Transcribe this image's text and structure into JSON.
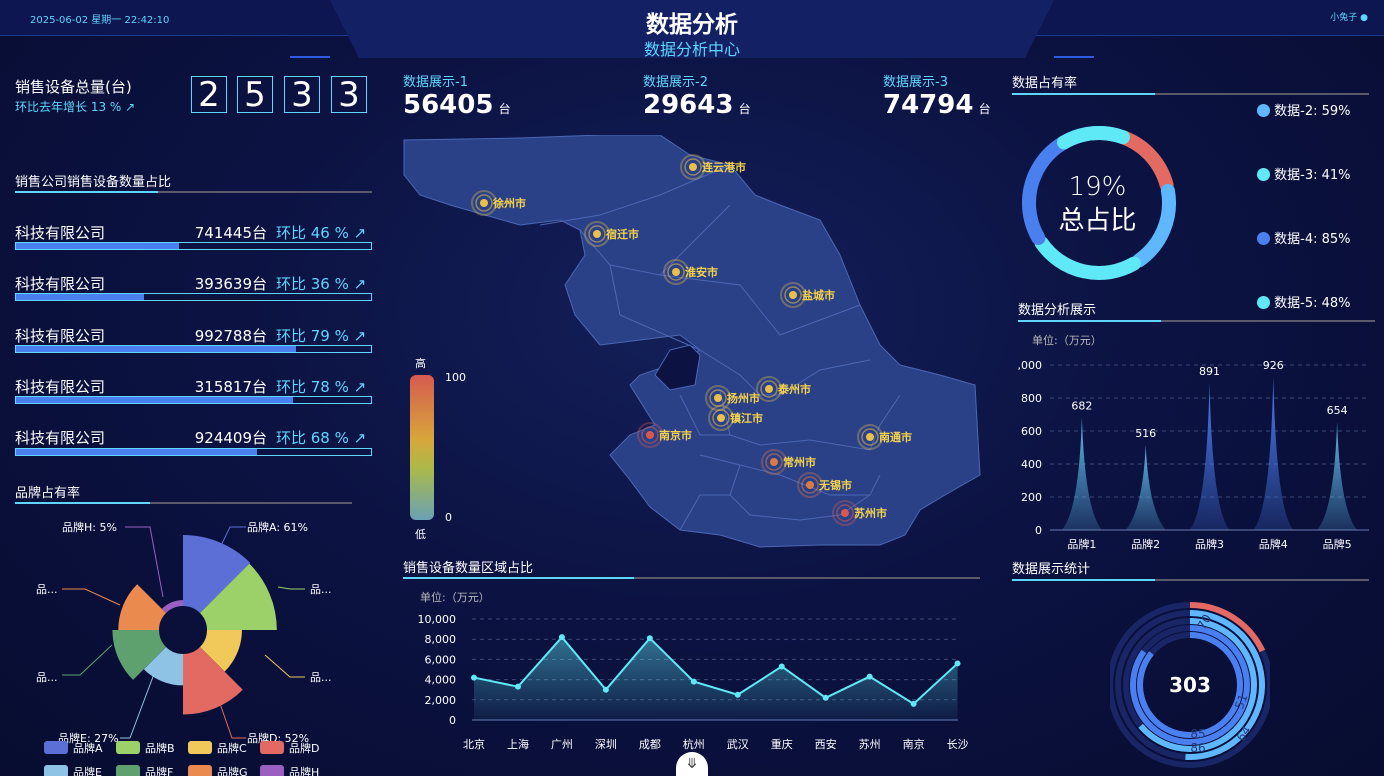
{
  "header": {
    "datetime": "2025-06-02 星期一 22:42:10",
    "title": "数据分析",
    "subtitle": "数据分析中心",
    "user": "小兔子"
  },
  "left": {
    "total": {
      "label": "销售设备总量(台)",
      "growth": "环比去年增长 13 %",
      "digits": [
        "2",
        "5",
        "3",
        "3"
      ]
    },
    "companies_title": "销售公司销售设备数量占比",
    "companies": [
      {
        "name": "科技有限公司",
        "value": "741445台",
        "pct": "环比 46 %",
        "ratio": 0.46
      },
      {
        "name": "科技有限公司",
        "value": "393639台",
        "pct": "环比 36 %",
        "ratio": 0.36
      },
      {
        "name": "科技有限公司",
        "value": "992788台",
        "pct": "环比 79 %",
        "ratio": 0.79
      },
      {
        "name": "科技有限公司",
        "value": "315817台",
        "pct": "环比 78 %",
        "ratio": 0.78
      },
      {
        "name": "科技有限公司",
        "value": "924409台",
        "pct": "环比 68 %",
        "ratio": 0.68
      }
    ],
    "brand_title": "品牌占有率"
  },
  "center": {
    "stats": [
      {
        "label": "数据展示-1",
        "value": "56405",
        "unit": "台"
      },
      {
        "label": "数据展示-2",
        "value": "29643",
        "unit": "台"
      },
      {
        "label": "数据展示-3",
        "value": "74794",
        "unit": "台"
      }
    ],
    "legend": {
      "high": "高",
      "low": "低",
      "max": "100",
      "min": "0"
    },
    "cities": [
      "连云港市",
      "徐州市",
      "宿迁市",
      "淮安市",
      "盐城市",
      "扬州市",
      "泰州市",
      "镇江市",
      "南京市",
      "南通市",
      "常州市",
      "无锡市",
      "苏州市"
    ],
    "line_title": "销售设备数量区域占比",
    "bottom_icon": "chevron-down-icon"
  },
  "right": {
    "occupancy_title": "数据占有率",
    "donut_center": [
      "19%",
      "总占比"
    ],
    "donut_legend": [
      "数据-2: 59%",
      "数据-3: 41%",
      "数据-4: 85%",
      "数据-5: 48%"
    ],
    "analysis_title": "数据分析展示",
    "stats_title": "数据展示统计"
  },
  "chart_data": [
    {
      "type": "pie",
      "title": "",
      "variant": "rose",
      "categories": [
        "品牌A",
        "品牌B",
        "品牌C",
        "品牌D",
        "品牌E",
        "品牌F",
        "品牌G",
        "品牌H"
      ],
      "values": [
        61,
        60,
        30,
        52,
        27,
        40,
        35,
        5
      ],
      "labels": [
        "品牌A: 61%",
        "品...",
        "品...",
        "品牌D: 52%",
        "品牌E: 27%",
        "品...",
        "品...",
        "品牌H: 5%"
      ],
      "colors": [
        "#5b6fd6",
        "#9cd16a",
        "#f1c85a",
        "#e36a63",
        "#8ec3e6",
        "#5ea06e",
        "#ea8a4f",
        "#9a5fc0"
      ],
      "legend": "bottom"
    },
    {
      "type": "area",
      "title": "",
      "unit_label": "单位:（万元）",
      "categories": [
        "北京",
        "上海",
        "广州",
        "深圳",
        "成都",
        "杭州",
        "武汉",
        "重庆",
        "西安",
        "苏州",
        "南京",
        "长沙"
      ],
      "values": [
        4200,
        3300,
        8200,
        3000,
        8100,
        3800,
        2500,
        5300,
        2200,
        4300,
        1600,
        5600
      ],
      "ylim": [
        0,
        10000
      ],
      "yticks": [
        "0",
        "2,000",
        "4,000",
        "6,000",
        "8,000",
        "10,000"
      ],
      "grid": true
    },
    {
      "type": "bar",
      "title": "",
      "variant": "pictorial-triangle",
      "unit_label": "单位:（万元）",
      "categories": [
        "品牌1",
        "品牌2",
        "品牌3",
        "品牌4",
        "品牌5"
      ],
      "values": [
        682,
        516,
        891,
        926,
        654
      ],
      "ylim": [
        0,
        1000
      ],
      "yticks": [
        "0",
        "200",
        "400",
        "600",
        "800",
        ",000"
      ],
      "grid": true
    },
    {
      "type": "pie",
      "title": "",
      "variant": "donut-segments",
      "categories": [
        "数据-2",
        "数据-3",
        "数据-4",
        "数据-5"
      ],
      "values": [
        59,
        41,
        85,
        48
      ],
      "colors": [
        "#5fb8ff",
        "#5fe8f5",
        "#4a7ff0",
        "#5fe8f5",
        "#e36a63"
      ]
    },
    {
      "type": "pie",
      "title": "",
      "variant": "concentric-rings",
      "center": "303",
      "values": [
        70,
        51,
        64,
        85,
        86
      ],
      "colors": [
        "#e36a63",
        "#5fb8ff",
        "#5fb8ff",
        "#4a7ff0",
        "#4a7ff0"
      ]
    }
  ]
}
